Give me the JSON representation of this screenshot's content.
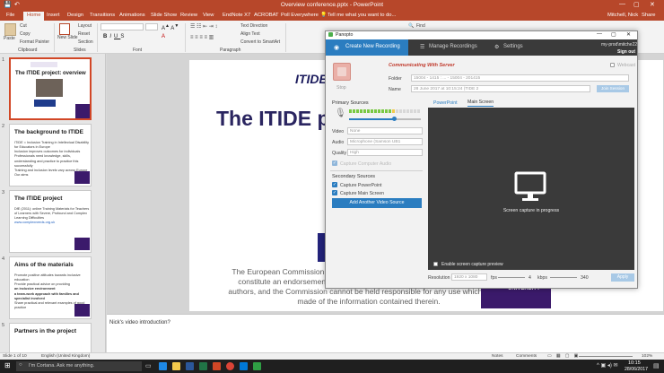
{
  "window": {
    "title": "Overview conference.pptx - PowerPoint"
  },
  "ribbon": {
    "tabs": [
      "File",
      "Home",
      "Insert",
      "Design",
      "Transitions",
      "Animations",
      "Slide Show",
      "Review",
      "View",
      "EndNote X7",
      "ACROBAT",
      "Poll Everywhere"
    ],
    "active_tab": "Home",
    "tell_me": "Tell me what you want to do...",
    "user": "Mitchell, Nick",
    "share": "Share",
    "clipboard": {
      "cut": "Cut",
      "copy": "Copy",
      "format_painter": "Format Painter",
      "paste": "Paste"
    },
    "slides": {
      "new_slide": "New Slide",
      "layout": "Layout",
      "reset": "Reset",
      "section": "Section"
    },
    "font_box": "",
    "paragraph": {
      "text_direction": "Text Direction",
      "align_text": "Align Text",
      "convert_smartart": "Convert to SmartArt"
    },
    "find": "Find",
    "groups": {
      "clipboard": "Clipboard",
      "slides": "Slides",
      "font": "Font",
      "paragraph": "Paragraph"
    }
  },
  "thumbs": [
    {
      "num": "1",
      "title": "The ITIDE project: overview",
      "lines": []
    },
    {
      "num": "2",
      "title": "The background to ITIDE",
      "lines": [
        "ITIDE = Inclusion Training in Intellectual Disability for Educators in Europe",
        "Inclusion improves outcomes for individuals",
        "Professionals need knowledge, skills, understanding and practice to practice this successfully",
        "Training and inclusion levels vary across Europe",
        "Our aims"
      ]
    },
    {
      "num": "3",
      "title": "The ITIDE project",
      "lines": [
        "DfE (2011): online Training Materials for Teachers of Learners with Severe, Profound and Complex Learning Difficulties",
        "www.complexneeds.org.uk"
      ]
    },
    {
      "num": "4",
      "title": "Aims of the materials",
      "lines": [
        "Promote positive attitudes towards inclusive education",
        "Provide practical advice on providing",
        "an inclusive environment",
        "a team-work approach with families and specialist involved",
        "Share practical and relevant examples of good practice"
      ]
    },
    {
      "num": "5",
      "title": "Partners in the project",
      "lines": []
    }
  ],
  "slide": {
    "logo_text": "ITIDE",
    "title": "The ITIDE p",
    "disclaimer": "The European Commission support for the production of this publication does not constitute an endorsement of the contents which reflects the views only of the authors, and the Commission cannot be held responsible for any use which may be made of the information contained therein.",
    "university": "UNIVERSITY"
  },
  "notes": {
    "text": "Nick's video introduction?"
  },
  "status": {
    "slide": "Slide 1 of 10",
    "language": "English (United Kingdom)",
    "notes": "Notes",
    "comments": "Comments",
    "zoom": "102%"
  },
  "taskbar": {
    "search": "I'm Cortana. Ask me anything.",
    "time": "10:15",
    "date": "28/06/2017"
  },
  "panopto": {
    "app_title": "Panopto",
    "tabs": {
      "create": "Create New Recording",
      "manage": "Manage Recordings",
      "settings": "Settings"
    },
    "user": "my-prod\\mitche22",
    "sign_out": "Sign out",
    "webcast": "Webcast",
    "status": "Communicating With Server",
    "stop": "Stop",
    "folder_label": "Folder",
    "folder_value": "15004 - 1415 : ... - 15004 - 201415",
    "name_label": "Name",
    "name_value": "28 June 2017 at 10:15:24 (TIDE 2",
    "join_session": "Join Session",
    "primary_sources": "Primary Sources",
    "video_label": "Video",
    "video_value": "None",
    "audio_label": "Audio",
    "audio_value": "Microphone (Samson UB1",
    "quality_label": "Quality",
    "quality_value": "High",
    "capture_audio": "Capture Computer Audio",
    "audio_level": 0.62,
    "secondary_sources": "Secondary Sources",
    "capture_ppt": "Capture PowerPoint",
    "capture_main": "Capture Main Screen",
    "add_video_source": "Add Another Video Source",
    "preview_tabs": {
      "powerpoint": "PowerPoint",
      "main_screen": "Main Screen"
    },
    "preview_caption": "Screen capture in progress",
    "enable_preview": "Enable screen capture preview",
    "resolution_label": "Resolution",
    "resolution_value": "1920 x 1080",
    "fps_label": "fps",
    "fps_value": "4",
    "kbps_label": "kbps",
    "kbps_value": "340",
    "apply": "Apply",
    "colors": {
      "accent": "#2b7dc0",
      "status": "#c0392b",
      "nav": "#3a3a3a"
    }
  }
}
